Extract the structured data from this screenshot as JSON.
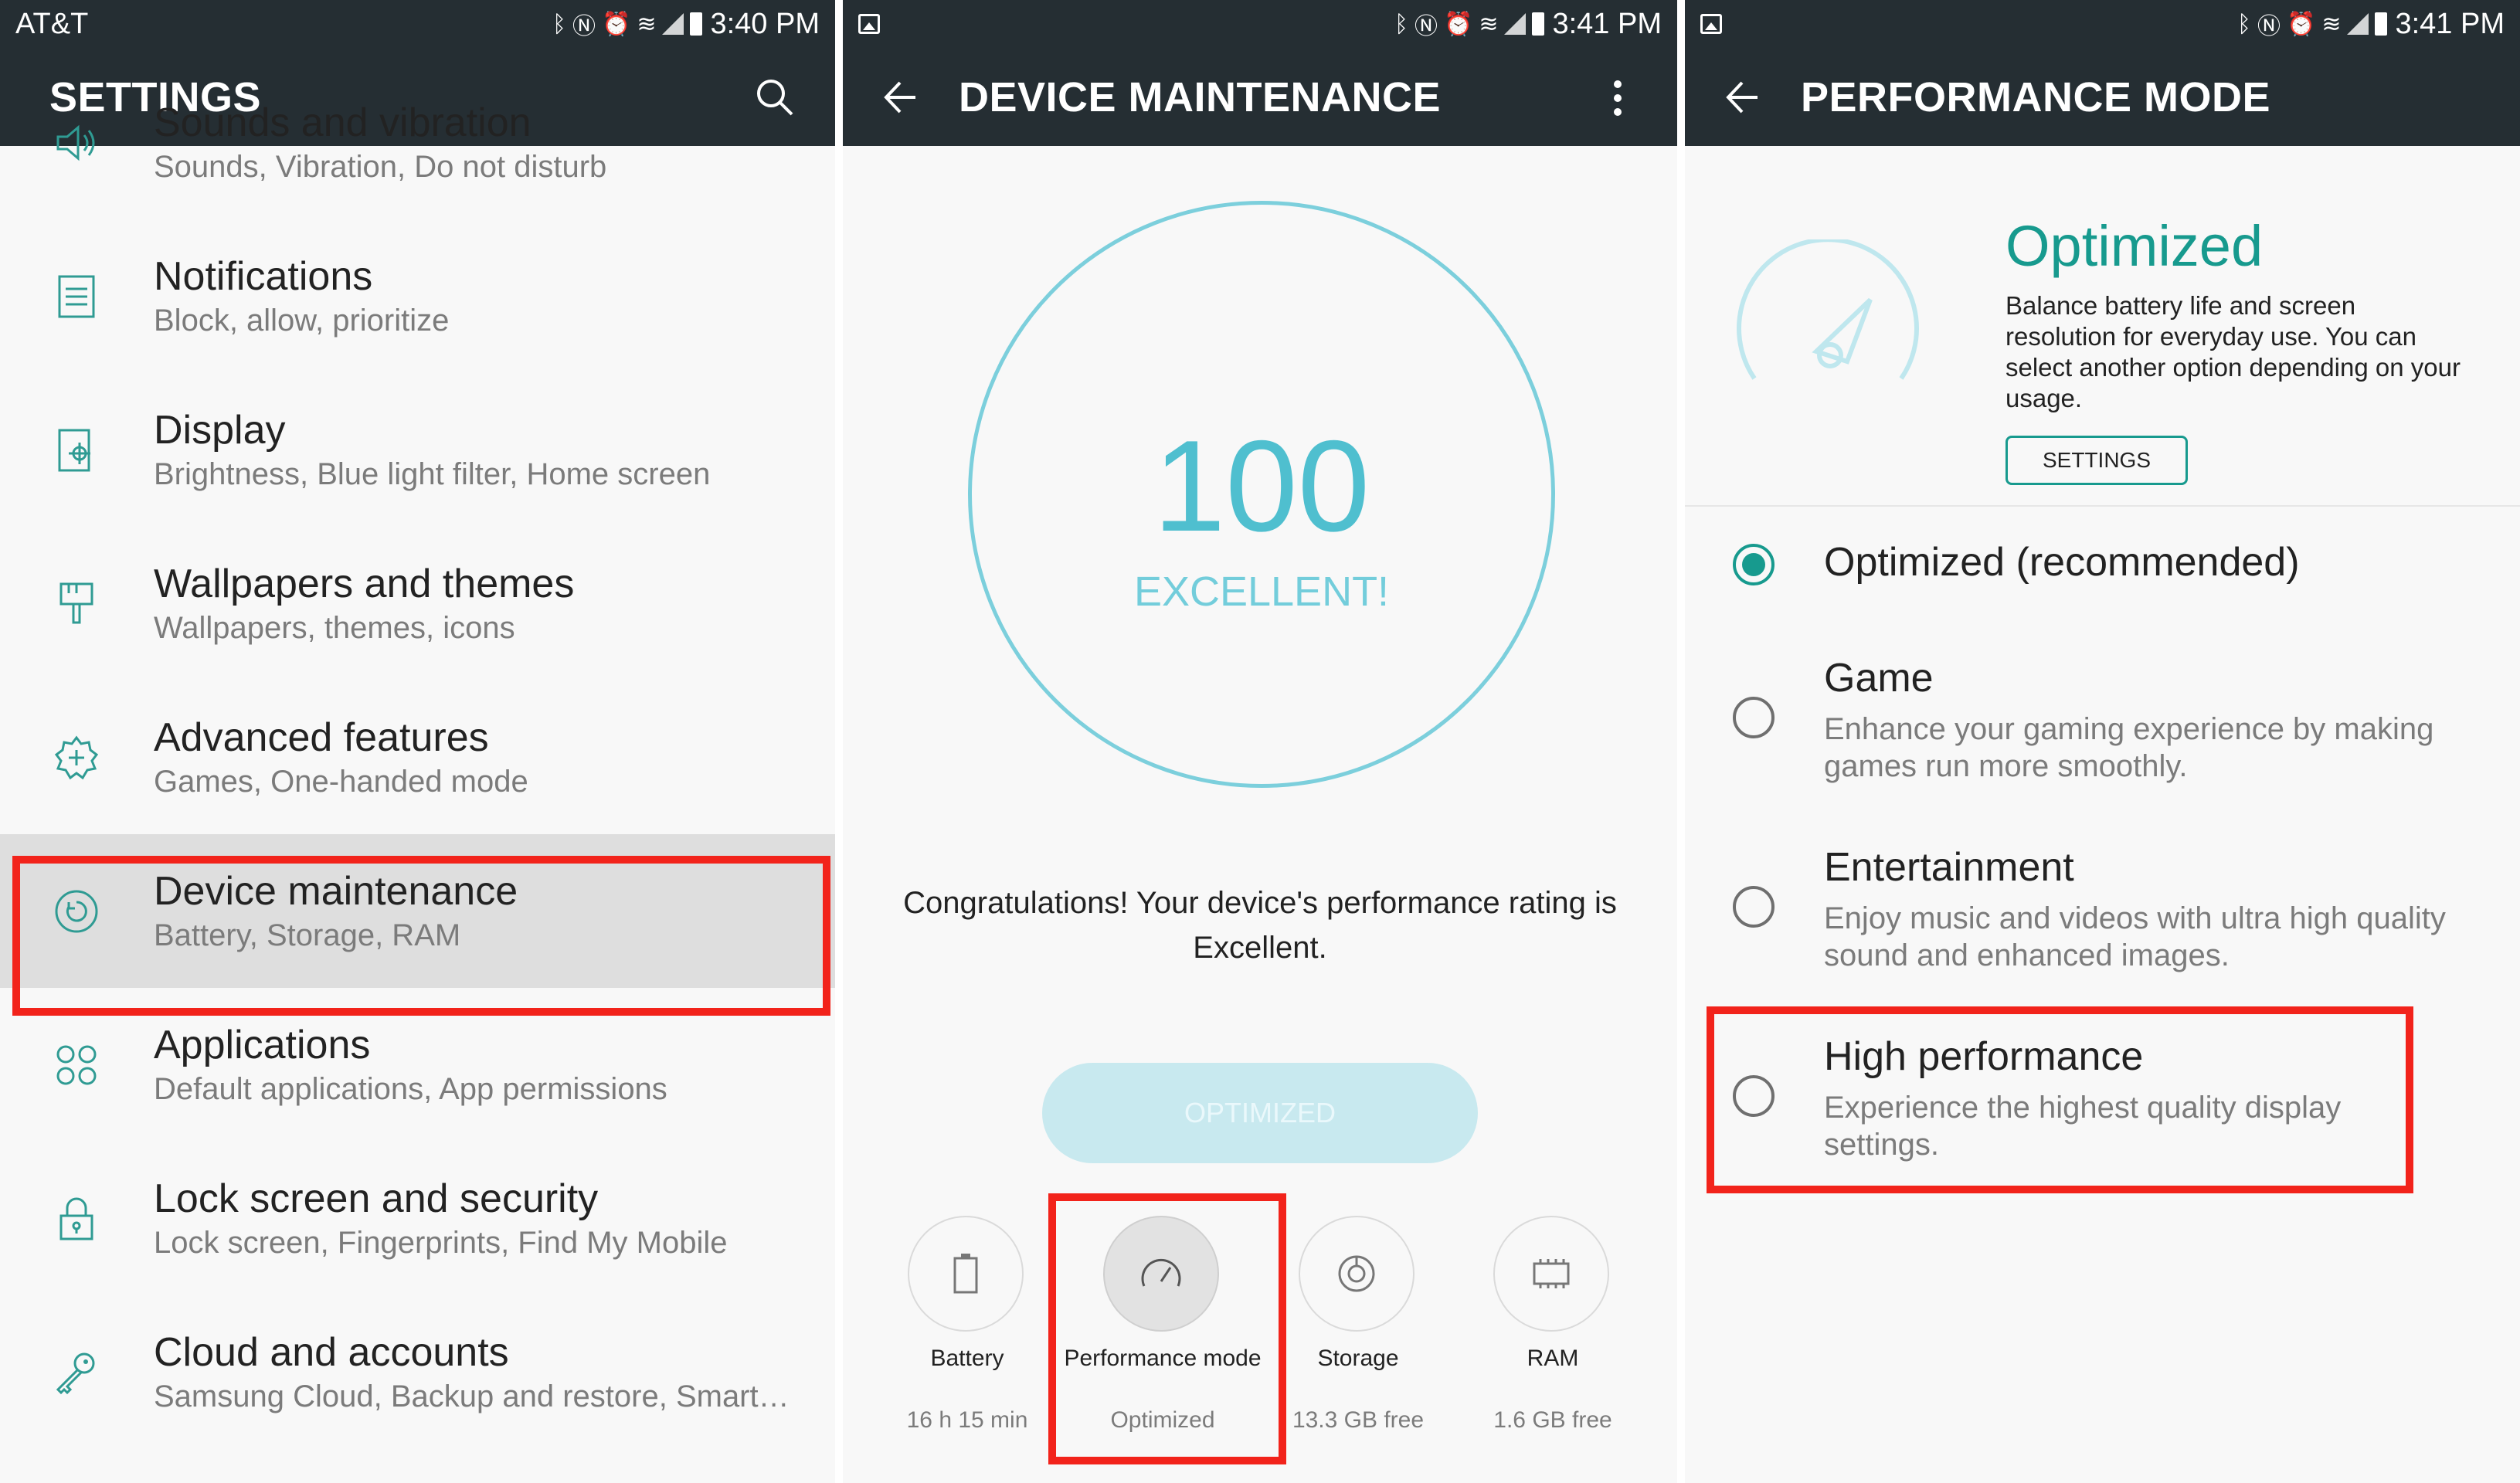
{
  "screen1": {
    "status": {
      "carrier": "AT&T",
      "time": "3:40 PM"
    },
    "title": "SETTINGS",
    "items": [
      {
        "title": "Sounds and vibration",
        "subtitle": "Sounds, Vibration, Do not disturb",
        "icon": "speaker-icon"
      },
      {
        "title": "Notifications",
        "subtitle": "Block, allow, prioritize",
        "icon": "notifications-icon"
      },
      {
        "title": "Display",
        "subtitle": "Brightness, Blue light filter, Home screen",
        "icon": "display-icon"
      },
      {
        "title": "Wallpapers and themes",
        "subtitle": "Wallpapers, themes, icons",
        "icon": "paintbrush-icon"
      },
      {
        "title": "Advanced features",
        "subtitle": "Games, One-handed mode",
        "icon": "advanced-gear-icon"
      },
      {
        "title": "Device maintenance",
        "subtitle": "Battery, Storage, RAM",
        "icon": "maintenance-icon"
      },
      {
        "title": "Applications",
        "subtitle": "Default applications, App permissions",
        "icon": "apps-grid-icon"
      },
      {
        "title": "Lock screen and security",
        "subtitle": "Lock screen, Fingerprints, Find My Mobile",
        "icon": "lock-icon"
      },
      {
        "title": "Cloud and accounts",
        "subtitle": "Samsung Cloud, Backup and restore, Smart…",
        "icon": "key-icon"
      }
    ]
  },
  "screen2": {
    "status": {
      "time": "3:41 PM"
    },
    "title": "DEVICE MAINTENANCE",
    "score": "100",
    "score_label": "EXCELLENT!",
    "message": "Congratulations! Your device's performance rating is Excellent.",
    "button": "OPTIMIZED",
    "tools": [
      {
        "name": "Battery",
        "value": "16 h 15 min",
        "icon": "battery-icon"
      },
      {
        "name": "Performance mode",
        "value": "Optimized",
        "icon": "speedometer-icon"
      },
      {
        "name": "Storage",
        "value": "13.3 GB free",
        "icon": "storage-icon"
      },
      {
        "name": "RAM",
        "value": "1.6 GB free",
        "icon": "ram-chip-icon"
      }
    ]
  },
  "screen3": {
    "status": {
      "time": "3:41 PM"
    },
    "title": "PERFORMANCE MODE",
    "header_title": "Optimized",
    "header_desc": "Balance battery life and screen resolution for everyday use. You can select another option depending on your usage.",
    "settings_button": "SETTINGS",
    "options": [
      {
        "title": "Optimized (recommended)",
        "subtitle": "",
        "selected": true
      },
      {
        "title": "Game",
        "subtitle": "Enhance your gaming experience by making games run more smoothly.",
        "selected": false
      },
      {
        "title": "Entertainment",
        "subtitle": "Enjoy music and videos with ultra high quality sound and enhanced images.",
        "selected": false
      },
      {
        "title": "High performance",
        "subtitle": "Experience the highest quality display settings.",
        "selected": false
      }
    ]
  },
  "colors": {
    "appbar": "#252e33",
    "accent": "#179a8e",
    "gauge": "#7ccfdc",
    "highlight": "#f2231b"
  }
}
